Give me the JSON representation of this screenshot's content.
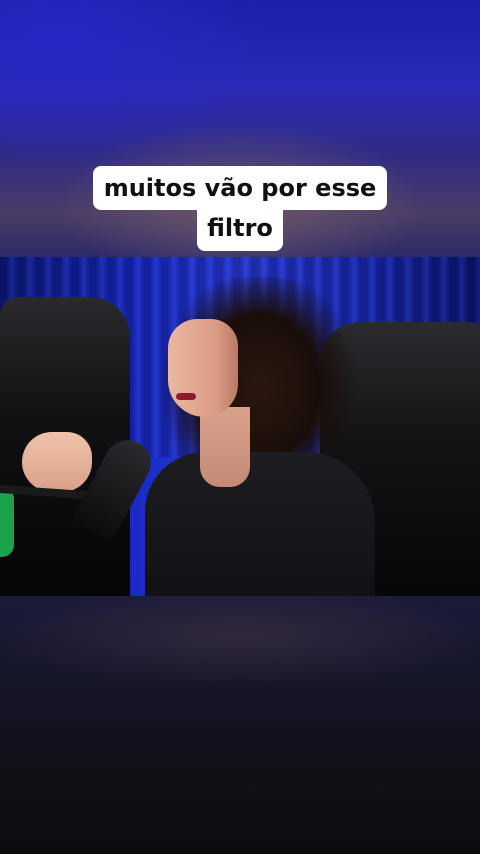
{
  "caption": {
    "line1": "muitos vão por esse",
    "line2": "filtro"
  }
}
